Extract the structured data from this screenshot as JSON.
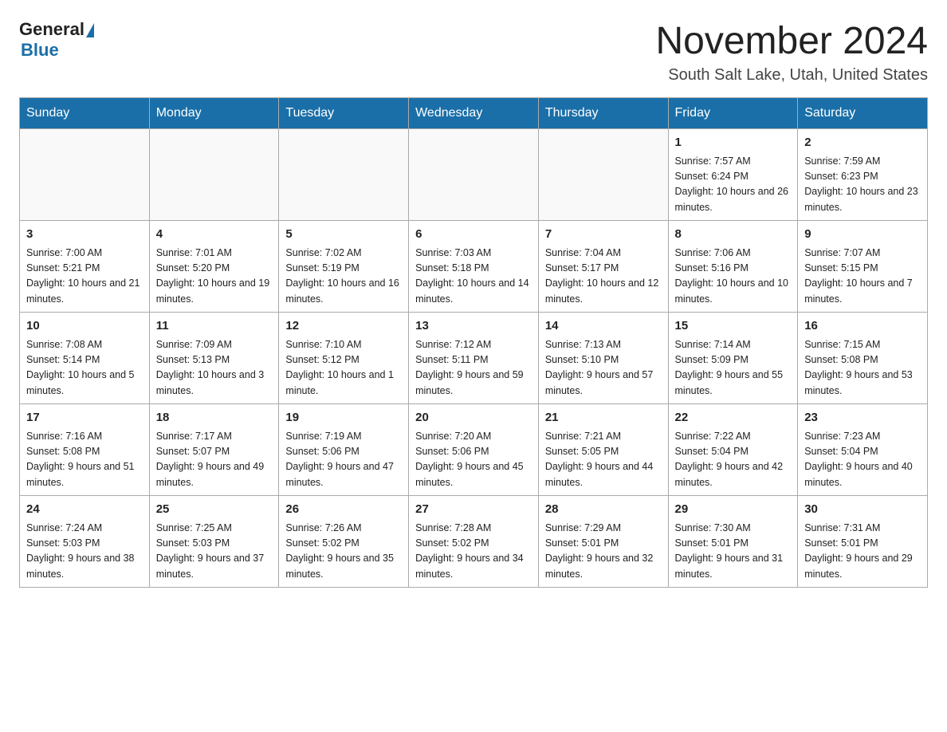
{
  "logo": {
    "general": "General",
    "blue": "Blue"
  },
  "title": "November 2024",
  "subtitle": "South Salt Lake, Utah, United States",
  "weekdays": [
    "Sunday",
    "Monday",
    "Tuesday",
    "Wednesday",
    "Thursday",
    "Friday",
    "Saturday"
  ],
  "weeks": [
    [
      {
        "day": "",
        "info": ""
      },
      {
        "day": "",
        "info": ""
      },
      {
        "day": "",
        "info": ""
      },
      {
        "day": "",
        "info": ""
      },
      {
        "day": "",
        "info": ""
      },
      {
        "day": "1",
        "info": "Sunrise: 7:57 AM\nSunset: 6:24 PM\nDaylight: 10 hours and 26 minutes."
      },
      {
        "day": "2",
        "info": "Sunrise: 7:59 AM\nSunset: 6:23 PM\nDaylight: 10 hours and 23 minutes."
      }
    ],
    [
      {
        "day": "3",
        "info": "Sunrise: 7:00 AM\nSunset: 5:21 PM\nDaylight: 10 hours and 21 minutes."
      },
      {
        "day": "4",
        "info": "Sunrise: 7:01 AM\nSunset: 5:20 PM\nDaylight: 10 hours and 19 minutes."
      },
      {
        "day": "5",
        "info": "Sunrise: 7:02 AM\nSunset: 5:19 PM\nDaylight: 10 hours and 16 minutes."
      },
      {
        "day": "6",
        "info": "Sunrise: 7:03 AM\nSunset: 5:18 PM\nDaylight: 10 hours and 14 minutes."
      },
      {
        "day": "7",
        "info": "Sunrise: 7:04 AM\nSunset: 5:17 PM\nDaylight: 10 hours and 12 minutes."
      },
      {
        "day": "8",
        "info": "Sunrise: 7:06 AM\nSunset: 5:16 PM\nDaylight: 10 hours and 10 minutes."
      },
      {
        "day": "9",
        "info": "Sunrise: 7:07 AM\nSunset: 5:15 PM\nDaylight: 10 hours and 7 minutes."
      }
    ],
    [
      {
        "day": "10",
        "info": "Sunrise: 7:08 AM\nSunset: 5:14 PM\nDaylight: 10 hours and 5 minutes."
      },
      {
        "day": "11",
        "info": "Sunrise: 7:09 AM\nSunset: 5:13 PM\nDaylight: 10 hours and 3 minutes."
      },
      {
        "day": "12",
        "info": "Sunrise: 7:10 AM\nSunset: 5:12 PM\nDaylight: 10 hours and 1 minute."
      },
      {
        "day": "13",
        "info": "Sunrise: 7:12 AM\nSunset: 5:11 PM\nDaylight: 9 hours and 59 minutes."
      },
      {
        "day": "14",
        "info": "Sunrise: 7:13 AM\nSunset: 5:10 PM\nDaylight: 9 hours and 57 minutes."
      },
      {
        "day": "15",
        "info": "Sunrise: 7:14 AM\nSunset: 5:09 PM\nDaylight: 9 hours and 55 minutes."
      },
      {
        "day": "16",
        "info": "Sunrise: 7:15 AM\nSunset: 5:08 PM\nDaylight: 9 hours and 53 minutes."
      }
    ],
    [
      {
        "day": "17",
        "info": "Sunrise: 7:16 AM\nSunset: 5:08 PM\nDaylight: 9 hours and 51 minutes."
      },
      {
        "day": "18",
        "info": "Sunrise: 7:17 AM\nSunset: 5:07 PM\nDaylight: 9 hours and 49 minutes."
      },
      {
        "day": "19",
        "info": "Sunrise: 7:19 AM\nSunset: 5:06 PM\nDaylight: 9 hours and 47 minutes."
      },
      {
        "day": "20",
        "info": "Sunrise: 7:20 AM\nSunset: 5:06 PM\nDaylight: 9 hours and 45 minutes."
      },
      {
        "day": "21",
        "info": "Sunrise: 7:21 AM\nSunset: 5:05 PM\nDaylight: 9 hours and 44 minutes."
      },
      {
        "day": "22",
        "info": "Sunrise: 7:22 AM\nSunset: 5:04 PM\nDaylight: 9 hours and 42 minutes."
      },
      {
        "day": "23",
        "info": "Sunrise: 7:23 AM\nSunset: 5:04 PM\nDaylight: 9 hours and 40 minutes."
      }
    ],
    [
      {
        "day": "24",
        "info": "Sunrise: 7:24 AM\nSunset: 5:03 PM\nDaylight: 9 hours and 38 minutes."
      },
      {
        "day": "25",
        "info": "Sunrise: 7:25 AM\nSunset: 5:03 PM\nDaylight: 9 hours and 37 minutes."
      },
      {
        "day": "26",
        "info": "Sunrise: 7:26 AM\nSunset: 5:02 PM\nDaylight: 9 hours and 35 minutes."
      },
      {
        "day": "27",
        "info": "Sunrise: 7:28 AM\nSunset: 5:02 PM\nDaylight: 9 hours and 34 minutes."
      },
      {
        "day": "28",
        "info": "Sunrise: 7:29 AM\nSunset: 5:01 PM\nDaylight: 9 hours and 32 minutes."
      },
      {
        "day": "29",
        "info": "Sunrise: 7:30 AM\nSunset: 5:01 PM\nDaylight: 9 hours and 31 minutes."
      },
      {
        "day": "30",
        "info": "Sunrise: 7:31 AM\nSunset: 5:01 PM\nDaylight: 9 hours and 29 minutes."
      }
    ]
  ]
}
